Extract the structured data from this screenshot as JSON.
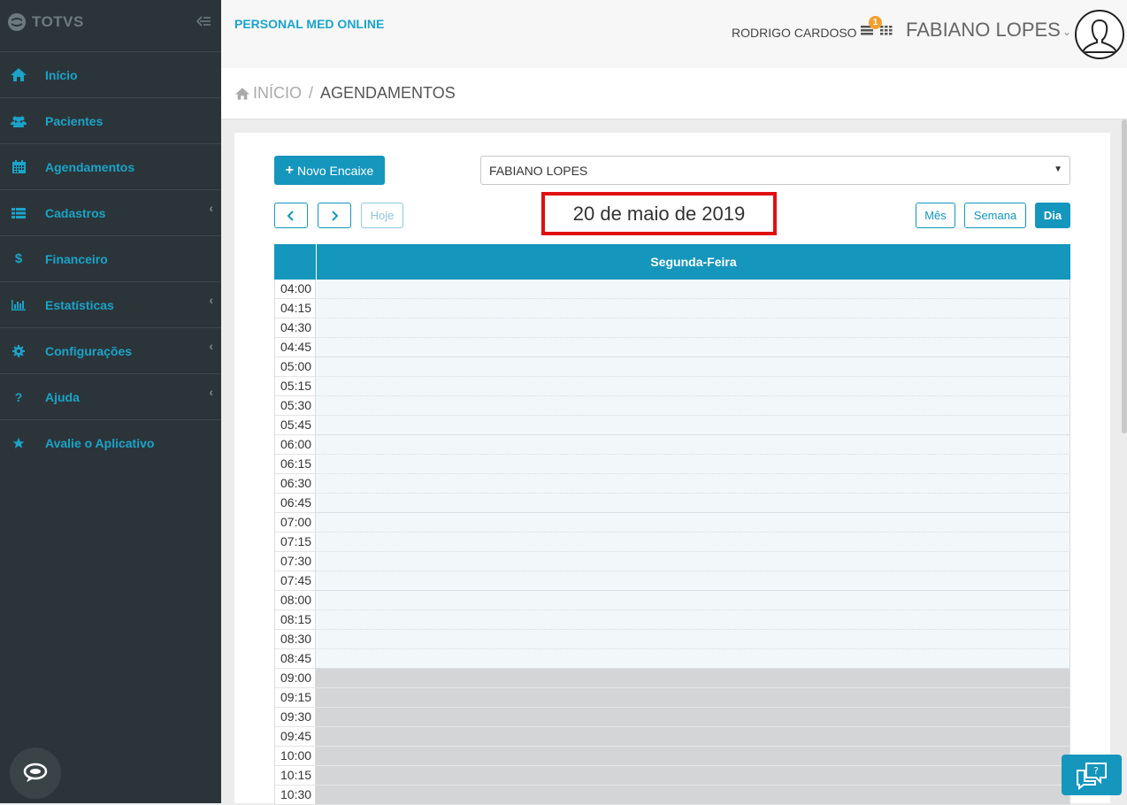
{
  "sidebar": {
    "logo": "TOTVS",
    "items": [
      {
        "label": "Início",
        "icon": "home-icon",
        "has_children": false
      },
      {
        "label": "Pacientes",
        "icon": "users-icon",
        "has_children": false
      },
      {
        "label": "Agendamentos",
        "icon": "calendar-icon",
        "has_children": false
      },
      {
        "label": "Cadastros",
        "icon": "list-icon",
        "has_children": true
      },
      {
        "label": "Financeiro",
        "icon": "dollar-icon",
        "has_children": false
      },
      {
        "label": "Estatísticas",
        "icon": "bar-chart-icon",
        "has_children": true
      },
      {
        "label": "Configurações",
        "icon": "gear-icon",
        "has_children": true
      },
      {
        "label": "Ajuda",
        "icon": "question-icon",
        "has_children": true
      },
      {
        "label": "Avalie o Aplicativo",
        "icon": "star-icon",
        "has_children": false
      }
    ]
  },
  "header": {
    "brand": "PERSONAL MED ONLINE",
    "secondary_user": "RODRIGO CARDOSO",
    "tasks_badge": "1",
    "user_name": "FABIANO LOPES"
  },
  "breadcrumb": {
    "home": "INÍCIO",
    "separator": "/",
    "current": "AGENDAMENTOS"
  },
  "toolbar": {
    "new_button": "Novo Encaixe",
    "professional_select": "FABIANO LOPES",
    "today": "Hoje",
    "date_title": "20 de maio de 2019",
    "views": {
      "month": "Mês",
      "week": "Semana",
      "day": "Dia"
    },
    "active_view": "day"
  },
  "calendar": {
    "day_header": "Segunda-Feira",
    "slots": [
      {
        "time": "04:00",
        "state": "available"
      },
      {
        "time": "04:15",
        "state": "available"
      },
      {
        "time": "04:30",
        "state": "available"
      },
      {
        "time": "04:45",
        "state": "available"
      },
      {
        "time": "05:00",
        "state": "available"
      },
      {
        "time": "05:15",
        "state": "available"
      },
      {
        "time": "05:30",
        "state": "available"
      },
      {
        "time": "05:45",
        "state": "available"
      },
      {
        "time": "06:00",
        "state": "available"
      },
      {
        "time": "06:15",
        "state": "available"
      },
      {
        "time": "06:30",
        "state": "available"
      },
      {
        "time": "06:45",
        "state": "available"
      },
      {
        "time": "07:00",
        "state": "available"
      },
      {
        "time": "07:15",
        "state": "available"
      },
      {
        "time": "07:30",
        "state": "available"
      },
      {
        "time": "07:45",
        "state": "available"
      },
      {
        "time": "08:00",
        "state": "available"
      },
      {
        "time": "08:15",
        "state": "available"
      },
      {
        "time": "08:30",
        "state": "available"
      },
      {
        "time": "08:45",
        "state": "available"
      },
      {
        "time": "09:00",
        "state": "blocked"
      },
      {
        "time": "09:15",
        "state": "blocked"
      },
      {
        "time": "09:30",
        "state": "blocked"
      },
      {
        "time": "09:45",
        "state": "blocked"
      },
      {
        "time": "10:00",
        "state": "blocked"
      },
      {
        "time": "10:15",
        "state": "blocked"
      },
      {
        "time": "10:30",
        "state": "blocked"
      }
    ]
  },
  "colors": {
    "accent": "#1596bd",
    "sidebar_bg": "#2b3539",
    "highlight_border": "#e01010",
    "available_slot": "#f2f8fa",
    "blocked_slot": "#d3d5d7"
  }
}
